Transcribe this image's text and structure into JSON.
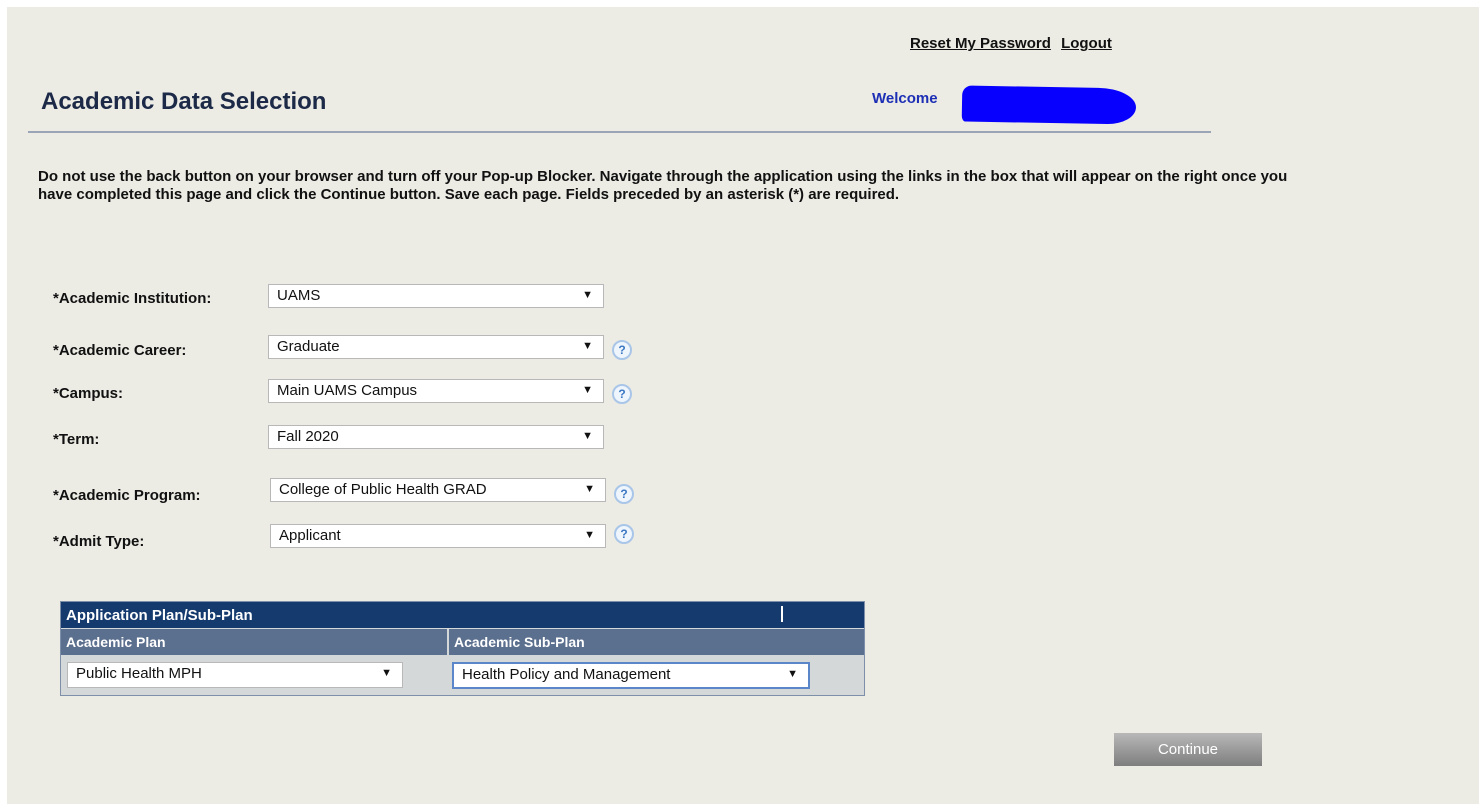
{
  "header": {
    "reset_password": "Reset My Password",
    "logout": "Logout",
    "title": "Academic Data Selection",
    "welcome": "Welcome"
  },
  "notice": "Do not use the back button on your browser and turn off your Pop-up Blocker.  Navigate through the application using the links in the box that will appear on the right once you have completed this page and click the Continue button.  Save each page.  Fields preceded by an asterisk (*) are required.",
  "form": {
    "institution": {
      "label": "*Academic Institution:",
      "value": "UAMS"
    },
    "career": {
      "label": "*Academic Career:",
      "value": "Graduate"
    },
    "campus": {
      "label": "*Campus:",
      "value": "Main UAMS Campus"
    },
    "term": {
      "label": "*Term:",
      "value": "Fall 2020"
    },
    "program": {
      "label": "*Academic Program:",
      "value": "College of Public Health GRAD"
    },
    "admit_type": {
      "label": "*Admit Type:",
      "value": "Applicant"
    }
  },
  "plan_table": {
    "title": "Application Plan/Sub-Plan",
    "col_plan": "Academic Plan",
    "col_subplan": "Academic Sub-Plan",
    "plan_value": "Public Health MPH",
    "subplan_value": "Health Policy and Management"
  },
  "help_icon_glyph": "?",
  "dropdown_glyph": "▼",
  "continue_label": "Continue",
  "colors": {
    "header_blue": "#143a6e",
    "subheader": "#5b6f8e",
    "background": "#ecebe4",
    "welcome": "#1c2fb5"
  }
}
